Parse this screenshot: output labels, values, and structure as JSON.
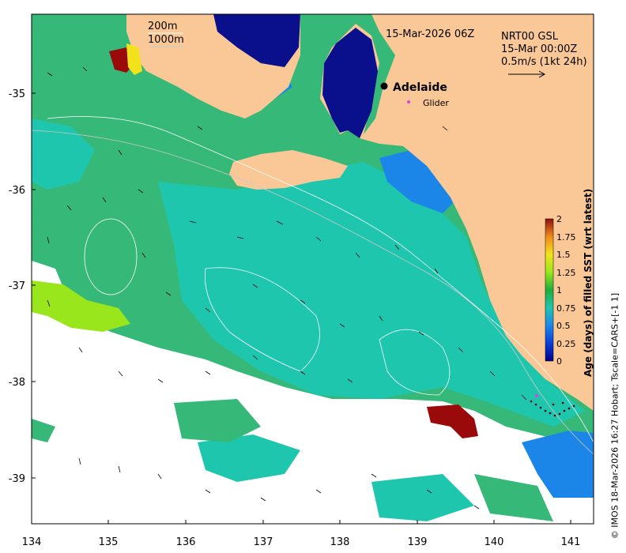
{
  "map": {
    "date_label": "15-Mar-2026 06Z",
    "product_lines": [
      "NRT00 GSL",
      "15-Mar 00:00Z",
      "0.5m/s (1kt 24h)"
    ],
    "depth_labels": [
      "200m",
      "1000m"
    ],
    "city": "Adelaide",
    "glider_label": "Glider",
    "x_ticks": [
      "134",
      "135",
      "136",
      "137",
      "138",
      "139",
      "140",
      "141"
    ],
    "y_ticks": [
      "-35",
      "-36",
      "-37",
      "-38",
      "-39"
    ],
    "colorbar_label": "Age (days) of filled SST (wrt latest)",
    "colorbar_ticks": [
      "0",
      "0.25",
      "0.5",
      "0.75",
      "1",
      "1.25",
      "1.5",
      "1.75",
      "2"
    ],
    "credit": "© IMOS 18-Mar-2026 16:27 Hobart; Tscale=CARS+[-1 1]"
  },
  "colors": {
    "land": "#FAC897",
    "sea_green": "#36B879",
    "sea_teal": "#1FC6AE",
    "no_data": "#FFFFFF",
    "deep_blue": "#0A0F8C",
    "dark_red": "#9A0A0A",
    "glider": "#E040E0"
  }
}
